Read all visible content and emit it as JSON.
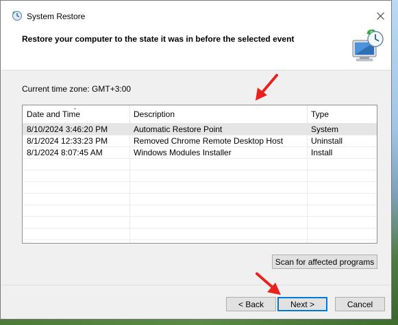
{
  "window": {
    "title": "System Restore",
    "heading": "Restore your computer to the state it was in before the selected event"
  },
  "timezone": "Current time zone: GMT+3:00",
  "table": {
    "columns": [
      "Date and Time",
      "Description",
      "Type"
    ],
    "rows": [
      {
        "date": "8/10/2024 3:46:20 PM",
        "description": "Automatic Restore Point",
        "type": "System"
      },
      {
        "date": "8/1/2024 12:33:23 PM",
        "description": "Removed Chrome Remote Desktop Host",
        "type": "Uninstall"
      },
      {
        "date": "8/1/2024 8:07:45 AM",
        "description": "Windows Modules Installer",
        "type": "Install"
      }
    ]
  },
  "buttons": {
    "scan": "Scan for affected programs",
    "back": "< Back",
    "next": "Next >",
    "cancel": "Cancel"
  },
  "colors": {
    "accent": "#0078d7",
    "annotation_arrow": "#e8231f",
    "selected_row": "#e5e5e5"
  }
}
